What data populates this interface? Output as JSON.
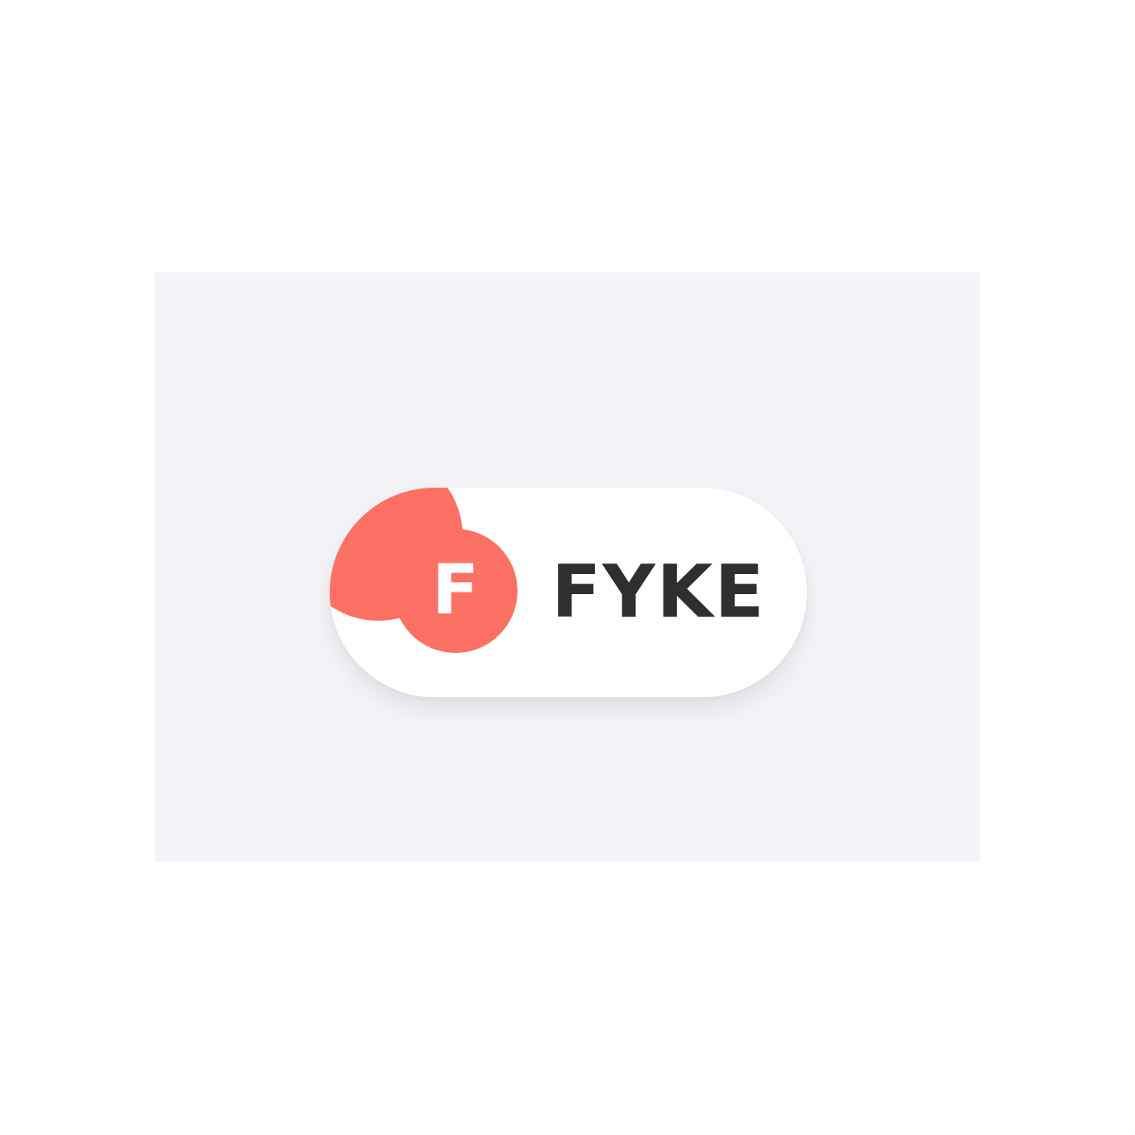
{
  "logo": {
    "initial": "F",
    "name": "FYKE",
    "accent_color": "#fd7064",
    "text_color": "#2f2f2f",
    "background_color": "#f4f4f8"
  }
}
